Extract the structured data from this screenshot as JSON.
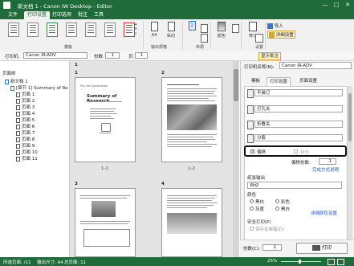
{
  "window": {
    "title": "新文档 1 - Canon iW Desktop - Editor",
    "minimize": "—",
    "maximize": "□",
    "close": "✕"
  },
  "menu": {
    "tabs": [
      {
        "label": "文件"
      },
      {
        "label": "打印设置"
      },
      {
        "label": "打印选项"
      },
      {
        "label": "批注"
      },
      {
        "label": "工具"
      }
    ]
  },
  "ribbon": {
    "templates_label": "模板",
    "paper_size": "A4",
    "orientation": "纵向",
    "layout_value": "1",
    "output_format_label": "输出规格",
    "layout_label": "布局",
    "finishing_label": "修订",
    "color_label": "颜色",
    "group_right_label": "设置",
    "import_label": "导入",
    "print_settings_label": "详细设置"
  },
  "printer_bar": {
    "printer_label": "打印机:",
    "printer_value": "Canon iR-ADV",
    "copies_label": "份数:",
    "copies_value": "1",
    "pages_label": "页:",
    "pages_value": "1",
    "status_button": "显示批注"
  },
  "tree": {
    "header": "页面树",
    "root": "新文档 1",
    "doc": "[章节 1] Summary of Re",
    "pages": [
      "页面 1",
      "页面 2",
      "页面 3",
      "页面 4",
      "页面 5",
      "页面 6",
      "页面 7",
      "页面 8",
      "页面 9",
      "页面 10",
      "页面 11"
    ]
  },
  "preview": {
    "section_marker": "1",
    "pages": [
      {
        "number": "1",
        "label": "1-1"
      },
      {
        "number": "2",
        "label": "1-2"
      },
      {
        "number": "3",
        "label": ""
      },
      {
        "number": "4",
        "label": ""
      }
    ],
    "summary_title": "Summary of Research",
    "company": "Pro-1st Corporation"
  },
  "settings_panel": {
    "printer_label": "打印机名称(N):",
    "printer_value": "Canon iR-ADV",
    "tabs": [
      {
        "label": "模板"
      },
      {
        "label": "打印设置"
      },
      {
        "label": "页面设置"
      }
    ],
    "staple_value": "不装订",
    "punch_value": "打孔关",
    "fold_value": "折叠关",
    "sort_value": "分套",
    "offset_checked": "✓",
    "offset_label": "偏移",
    "auto_label": "自动",
    "offset_copies_label": "偏移份数:",
    "offset_copies_value": "1",
    "finishing_detail_link": "完成方式说明",
    "output_tray_label": "纸张输出",
    "output_tray_value": "自动",
    "color_section": "颜色",
    "opt_bw": "黑白",
    "opt_color": "彩色",
    "opt_gray": "灰度",
    "opt_bw2": "黑白",
    "opt_bw3": "黑白",
    "color_detail_link": "详细颜色设置",
    "secure_label": "安全打印(P)",
    "secure_option": "保存在邮箱(D)",
    "copies_label": "份数(C):",
    "copies_value": "1",
    "print_button": "打印"
  },
  "status_bar": {
    "total_pages": "所选页面: /11",
    "output_size": "输出尺寸: A4",
    "total": "总页面: 11",
    "zoom": "25%"
  }
}
